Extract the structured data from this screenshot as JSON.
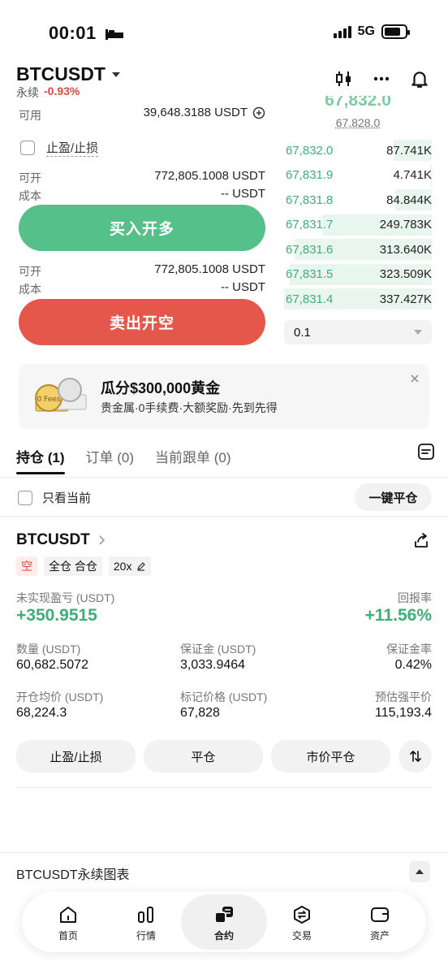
{
  "status_bar": {
    "time": "00:01",
    "network": "5G"
  },
  "header": {
    "pair": "BTCUSDT",
    "type": "永续",
    "change": "-0.93%"
  },
  "form": {
    "available_label": "可用",
    "available_value": "39,648.3188 USDT",
    "tpsl_label": "止盈/止损",
    "buy_open_label": "可开",
    "buy_open_value": "772,805.1008 USDT",
    "buy_cost_label": "成本",
    "buy_cost_value": "-- USDT",
    "buy_button": "买入开多",
    "sell_open_label": "可开",
    "sell_open_value": "772,805.1008 USDT",
    "sell_cost_label": "成本",
    "sell_cost_value": "-- USDT",
    "sell_button": "卖出开空"
  },
  "orderbook": {
    "last_price": "67,832.0",
    "mark_price": "67,828.0",
    "rows": [
      {
        "price": "67,832.0",
        "amount": "87.741K",
        "depth": 0.26
      },
      {
        "price": "67,831.9",
        "amount": "4.741K",
        "depth": 0.01
      },
      {
        "price": "67,831.8",
        "amount": "84.844K",
        "depth": 0.25
      },
      {
        "price": "67,831.7",
        "amount": "249.783K",
        "depth": 0.74
      },
      {
        "price": "67,831.6",
        "amount": "313.640K",
        "depth": 0.93
      },
      {
        "price": "67,831.5",
        "amount": "323.509K",
        "depth": 0.96
      },
      {
        "price": "67,831.4",
        "amount": "337.427K",
        "depth": 1.0
      }
    ],
    "depth_step": "0.1"
  },
  "banner": {
    "title": "瓜分$300,000黄金",
    "subtitle": "贵金属·0手续费·大额奖励·先到先得",
    "badge": "0 Fees"
  },
  "tabs": [
    {
      "label": "持仓 (1)"
    },
    {
      "label": "订单 (0)"
    },
    {
      "label": "当前跟单 (0)"
    }
  ],
  "filter": {
    "only_current": "只看当前",
    "close_all": "一键平仓"
  },
  "position": {
    "symbol": "BTCUSDT",
    "side": "空",
    "margin_mode": "全仓 合仓",
    "leverage": "20x",
    "pnl_label": "未实现盈亏 (USDT)",
    "pnl_value": "+350.9515",
    "roe_label": "回报率",
    "roe_value": "+11.56%",
    "qty_label": "数量 (USDT)",
    "qty_value": "60,682.5072",
    "margin_label": "保证金 (USDT)",
    "margin_value": "3,033.9464",
    "margin_ratio_label": "保证金率",
    "margin_ratio_value": "0.42%",
    "entry_label": "开仓均价 (USDT)",
    "entry_value": "68,224.3",
    "mark_label": "标记价格 (USDT)",
    "mark_value": "67,828",
    "liq_label": "预估强平价",
    "liq_value": "115,193.4",
    "btn_tpsl": "止盈/止损",
    "btn_close": "平仓",
    "btn_market_close": "市价平仓"
  },
  "chart_section": {
    "label": "BTCUSDT永续图表"
  },
  "bottom_nav": [
    {
      "label": "首页",
      "icon": "home-icon"
    },
    {
      "label": "行情",
      "icon": "market-icon"
    },
    {
      "label": "合约",
      "icon": "futures-icon",
      "active": true
    },
    {
      "label": "交易",
      "icon": "trade-icon"
    },
    {
      "label": "资产",
      "icon": "wallet-icon"
    }
  ],
  "colors": {
    "green": "#55c08a",
    "red": "#e5574a",
    "text_green": "#3fae77"
  }
}
